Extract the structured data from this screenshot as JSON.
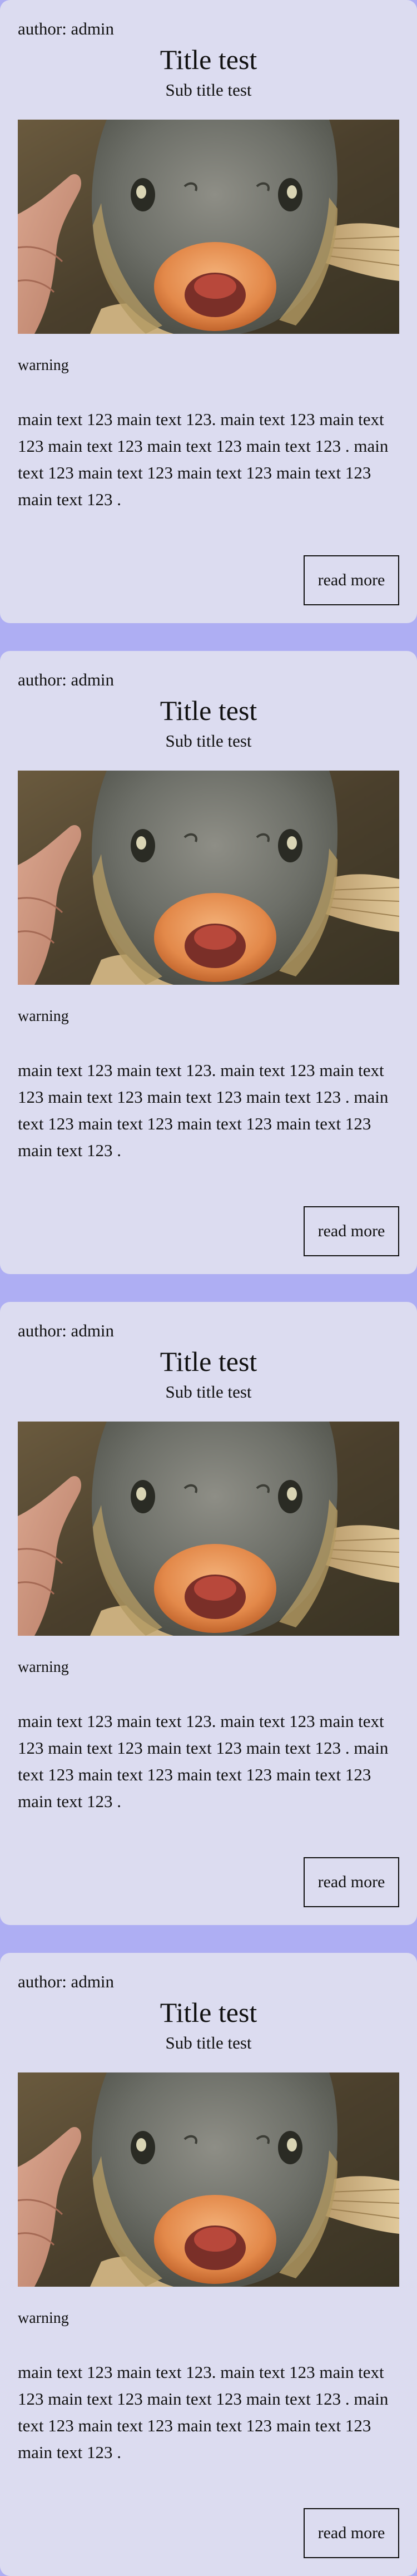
{
  "posts": [
    {
      "author": "author: admin",
      "title": "Title test",
      "subtitle": "Sub title test",
      "image_alt": "fish",
      "warning": "warning",
      "main_text": "main text 123 main text 123. main text 123 main text 123 main text 123 main text 123 main text 123 . main text 123 main text 123 main text 123 main text 123 main text 123 .",
      "read_more": "read more"
    },
    {
      "author": "author: admin",
      "title": "Title test",
      "subtitle": "Sub title test",
      "image_alt": "fish",
      "warning": "warning",
      "main_text": "main text 123 main text 123. main text 123 main text 123 main text 123 main text 123 main text 123 . main text 123 main text 123 main text 123 main text 123 main text 123 .",
      "read_more": "read more"
    },
    {
      "author": "author: admin",
      "title": "Title test",
      "subtitle": "Sub title test",
      "image_alt": "fish",
      "warning": "warning",
      "main_text": "main text 123 main text 123. main text 123 main text 123 main text 123 main text 123 main text 123 . main text 123 main text 123 main text 123 main text 123 main text 123 .",
      "read_more": "read more"
    },
    {
      "author": "author: admin",
      "title": "Title test",
      "subtitle": "Sub title test",
      "image_alt": "fish",
      "warning": "warning",
      "main_text": "main text 123 main text 123. main text 123 main text 123 main text 123 main text 123 main text 123 . main text 123 main text 123 main text 123 main text 123 main text 123 .",
      "read_more": "read more"
    }
  ],
  "colors": {
    "page_background": "#aeaef3",
    "card_background": "#dcdcf0"
  }
}
